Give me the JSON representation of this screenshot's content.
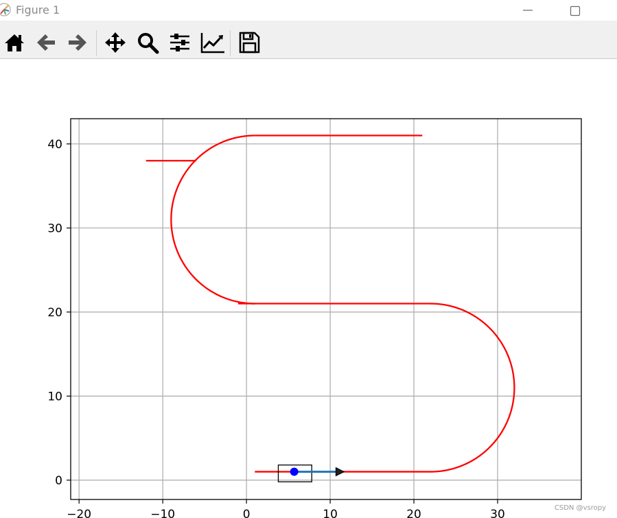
{
  "window": {
    "title": "Figure 1",
    "controls": [
      "minimize",
      "maximize"
    ]
  },
  "toolbar": {
    "buttons": [
      {
        "name": "home-icon"
      },
      {
        "name": "back-icon"
      },
      {
        "name": "forward-icon"
      },
      {
        "name": "pan-icon"
      },
      {
        "name": "zoom-icon"
      },
      {
        "name": "configure-subplots-icon"
      },
      {
        "name": "edit-axis-icon"
      },
      {
        "name": "save-icon"
      }
    ]
  },
  "colors": {
    "path": "#ff0000",
    "vehicle_point": "#0000ff",
    "heading_arrow": "#1f77b4",
    "grid": "#b0b0b0"
  },
  "watermark": "CSDN @vsropy",
  "chart_data": {
    "type": "line",
    "title": "",
    "xlabel": "",
    "ylabel": "",
    "xlim": [
      -21,
      40
    ],
    "ylim": [
      -2.3,
      43
    ],
    "xticks": [
      -20,
      -10,
      0,
      10,
      20,
      30
    ],
    "yticks": [
      0,
      10,
      20,
      30,
      40
    ],
    "grid": true,
    "series": [
      {
        "color": "#ff0000",
        "description": "planned path",
        "segments": [
          {
            "kind": "line",
            "from": [
              1,
              1
            ],
            "to": [
              22,
              1
            ]
          },
          {
            "kind": "arc",
            "center": [
              22,
              11
            ],
            "radius": 10,
            "from_deg": -90,
            "to_deg": 90
          },
          {
            "kind": "line",
            "from": [
              22,
              21
            ],
            "to": [
              -1,
              21
            ]
          },
          {
            "kind": "arc",
            "center": [
              1,
              31
            ],
            "radius": 10,
            "from_deg": 270,
            "to_deg": 90
          },
          {
            "kind": "line",
            "from": [
              1,
              41
            ],
            "to": [
              21,
              41
            ]
          },
          {
            "kind": "line",
            "from": [
              -12,
              38
            ],
            "to": [
              -6,
              38
            ]
          }
        ]
      }
    ],
    "vehicle": {
      "position": [
        5.7,
        1
      ],
      "box": {
        "x_min": 3.8,
        "x_max": 7.8,
        "y_min": -0.2,
        "y_max": 1.8
      },
      "arrow_to": [
        11.5,
        1
      ]
    }
  }
}
